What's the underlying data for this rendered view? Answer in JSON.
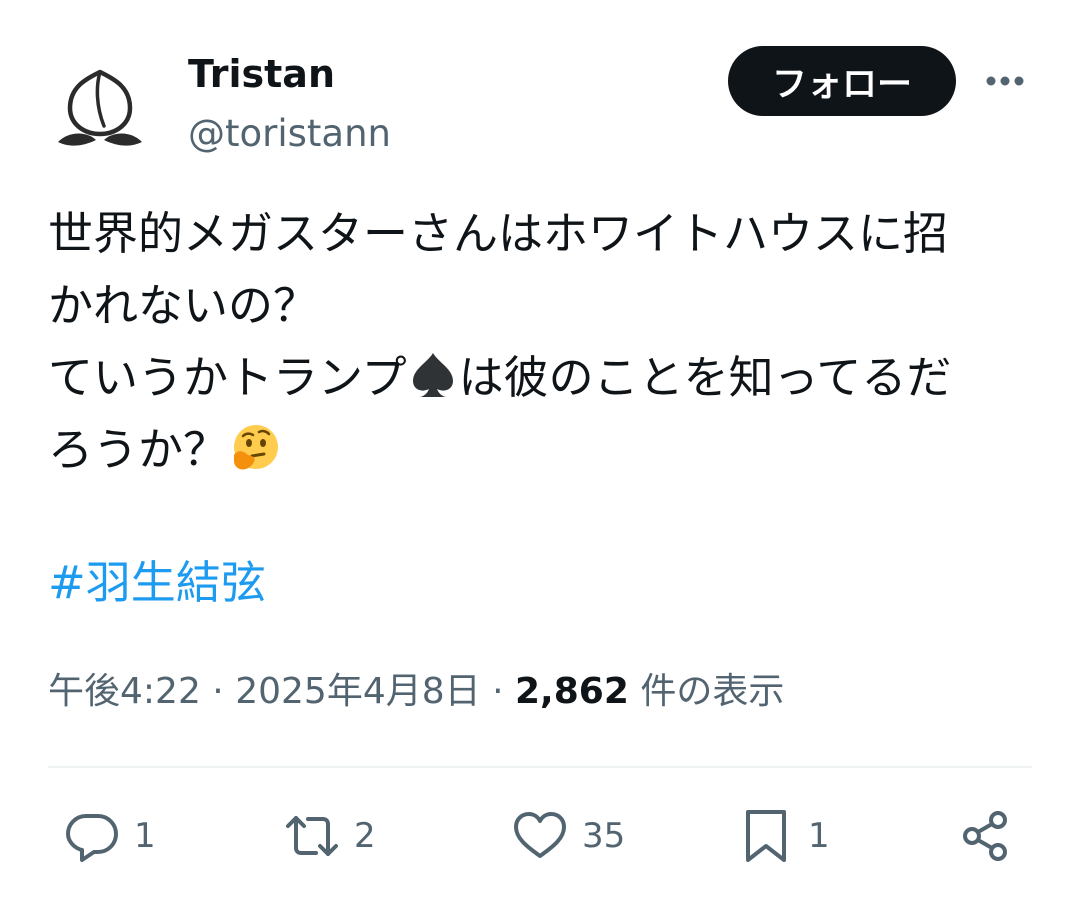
{
  "author": {
    "display_name": "Tristan",
    "handle": "@toristann"
  },
  "follow_label": "フォロー",
  "tweet": {
    "lines": [
      "世界的メガスターさんはホワイトハウスに招",
      "かれないの？",
      "ていうかトランプ",
      "は彼のことを知ってるだ",
      "ろうか？"
    ],
    "hashtag": "#羽生結弦",
    "emojis": [
      "spade-emoji",
      "thinking-face-emoji"
    ]
  },
  "meta": {
    "time": "午後4:22",
    "separator": "·",
    "date": "2025年4月8日",
    "views_count": "2,862",
    "views_label": "件の表示"
  },
  "actions": {
    "reply_count": "1",
    "retweet_count": "2",
    "like_count": "35",
    "bookmark_count": "1"
  },
  "colors": {
    "accent": "#1d9bf0",
    "text_primary": "#0f1419",
    "text_secondary": "#536471",
    "button_bg": "#0f1419",
    "divider": "#eff3f4"
  },
  "icons": [
    "peach-avatar-icon",
    "more-dots-icon",
    "reply-icon",
    "retweet-icon",
    "like-icon",
    "bookmark-icon",
    "share-icon"
  ]
}
